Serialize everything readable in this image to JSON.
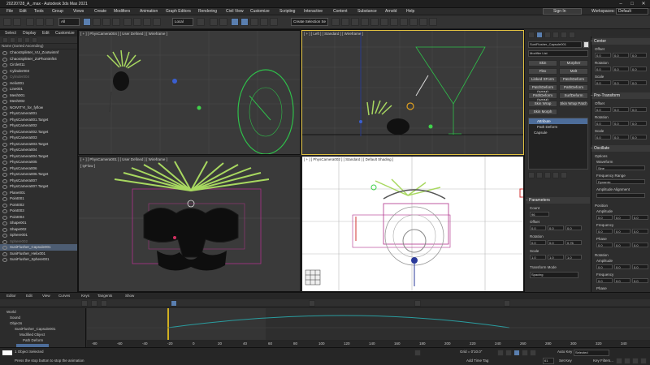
{
  "app": {
    "title": "20220728_A_.max - Autodesk 3ds Max 2021",
    "sign_in": "Sign In",
    "workspaces_label": "Workspaces:",
    "workspace": "Default"
  },
  "menu": [
    "File",
    "Edit",
    "Tools",
    "Group",
    "Views",
    "Create",
    "Modifiers",
    "Animation",
    "Graph Editors",
    "Rendering",
    "Civil View",
    "Customize",
    "Scripting",
    "Interactive",
    "Content",
    "Substance",
    "Arnold",
    "Help"
  ],
  "toolbar": {
    "filter": "All",
    "coord": "Local",
    "selection_set": "Create Selection Se"
  },
  "scene": {
    "tabs": [
      "Select",
      "Display",
      "Edit",
      "Customize"
    ],
    "header": "Name (Sorted Ascending)",
    "items": [
      {
        "name": "ChaosSplinter_VU_ZootwinInf",
        "state": "normal"
      },
      {
        "name": "ChaosSplinter_ZoPhontInf04",
        "state": "normal"
      },
      {
        "name": "Circle011",
        "state": "normal"
      },
      {
        "name": "Cylinder003",
        "state": "normal"
      },
      {
        "name": "Cylinder004",
        "state": "dim"
      },
      {
        "name": "Helix001",
        "state": "normal"
      },
      {
        "name": "Line001",
        "state": "normal"
      },
      {
        "name": "Mesh001",
        "state": "normal"
      },
      {
        "name": "Mesh002",
        "state": "normal"
      },
      {
        "name": "NOIVITYI_for_fyflow",
        "state": "normal"
      },
      {
        "name": "PhysCamera001",
        "state": "normal"
      },
      {
        "name": "PhysCamera001.Target",
        "state": "normal"
      },
      {
        "name": "PhysCamera002",
        "state": "normal"
      },
      {
        "name": "PhysCamera002.Target",
        "state": "normal"
      },
      {
        "name": "PhysCamera003",
        "state": "normal"
      },
      {
        "name": "PhysCamera003.Target",
        "state": "normal"
      },
      {
        "name": "PhysCamera004",
        "state": "normal"
      },
      {
        "name": "PhysCamera004.Target",
        "state": "normal"
      },
      {
        "name": "PhysCamera005",
        "state": "normal"
      },
      {
        "name": "PhysCamera006",
        "state": "normal"
      },
      {
        "name": "PhysCamera006.Target",
        "state": "normal"
      },
      {
        "name": "PhysCamera007",
        "state": "normal"
      },
      {
        "name": "PhysCamera007.Target",
        "state": "normal"
      },
      {
        "name": "Plane001",
        "state": "normal"
      },
      {
        "name": "Point001",
        "state": "normal"
      },
      {
        "name": "Point002",
        "state": "normal"
      },
      {
        "name": "Point003",
        "state": "normal"
      },
      {
        "name": "Point004",
        "state": "normal"
      },
      {
        "name": "Shape001",
        "state": "normal"
      },
      {
        "name": "Shape002",
        "state": "normal"
      },
      {
        "name": "Sphere001",
        "state": "normal"
      },
      {
        "name": "Sphere002",
        "state": "dim"
      },
      {
        "name": "SuniFlusher_Capsule001",
        "state": "selected"
      },
      {
        "name": "SuniFlusher_Helix001",
        "state": "normal"
      },
      {
        "name": "SuniFlusher_Sphere001",
        "state": "normal"
      }
    ]
  },
  "viewports": [
    {
      "label": "[ + ] [ PhysCamera004 ] [ User Defined ] [ Wireframe ]"
    },
    {
      "label": "[ + ] [ Left ] [ Standard ] [ Wireframe ]"
    },
    {
      "label": "[ + ] [ PhysCamera001 ] [ User Defined ] [ Wireframe ]",
      "extra": "[ tyFlow ]"
    },
    {
      "label": "[ + ] [ PhysCamera002 ] [ Standard ] [ Default Shading ]"
    }
  ],
  "cmd": {
    "object_name": "SuniFlusher_Capsule001",
    "modifier_list": "Modifier List",
    "buttons": [
      "Skin",
      "Morpher",
      "Flex",
      "Melt",
      "Linked XForm",
      "PatchDeform",
      "PatchDeform (WSM)",
      "PathDeform",
      "PathDeform (WSM)",
      "SurfDeform",
      "Skin Wrap",
      "Skin Wrap Patch",
      "Skin Morph"
    ],
    "stack": [
      "Attribute",
      "Path Deform",
      "Capsule"
    ],
    "params_title": "Parameters",
    "count_label": "Count",
    "count": "96",
    "offset_label": "Offset",
    "offset": [
      "0.0",
      "0.0",
      "0.0"
    ],
    "rotation_label": "Rotation",
    "rotation": [
      "0.0",
      "0.0",
      "0.76"
    ],
    "scale_label": "Scale",
    "scale": [
      "1.0",
      "1.0",
      "1.0"
    ],
    "transform_mode_label": "Transform Mode",
    "transform_mode": "Spacing"
  },
  "right": {
    "center": "Center",
    "offset": "Offset",
    "offset_v": [
      "0.0",
      "0.0",
      "0.0"
    ],
    "rotation": "Rotation",
    "scale": "Scale",
    "pre_transform": "Pre-Transform",
    "oscillate": "Oscillate",
    "options": "Options",
    "waveform": "Waveform",
    "waveform_v": "Sine",
    "freq_range": "Frequency Range",
    "freq_range_v": "Dynamic",
    "amp_align": "Amplitude Alignment",
    "position": "Position",
    "amplitude": "Amplitude",
    "frequency": "Frequency",
    "phase": "Phase",
    "phase_label": "Phase"
  },
  "track": {
    "menu": [
      "Editor",
      "Edit",
      "View",
      "Curves",
      "Keys",
      "Tangents",
      "Show"
    ],
    "tracks": [
      "World",
      "Sound",
      "Objects",
      "SuniFlusher_Capsule001",
      "Modified Object",
      "Path Deform"
    ],
    "ruler": [
      "-80",
      "-60",
      "-40",
      "-20",
      "0",
      "20",
      "40",
      "60",
      "80",
      "100",
      "120",
      "140",
      "160",
      "180",
      "200",
      "220",
      "240",
      "260",
      "280",
      "300",
      "320",
      "340"
    ]
  },
  "status": {
    "selected": "1 Object Selected",
    "prompt": "Press the stop button to stop the animation",
    "grid": "Grid = 0'10.0\"",
    "add_time_tag": "Add Time Tag",
    "auto_key": "Auto Key",
    "set_key": "Set Key",
    "selected_dd": "Selected",
    "key_filters": "Key Filters...",
    "frame": "61"
  }
}
